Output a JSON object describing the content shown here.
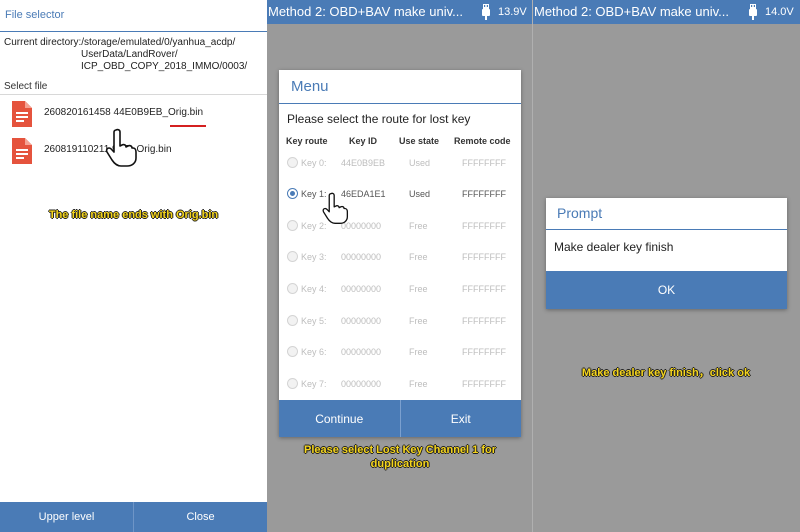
{
  "file_selector": {
    "title": "File selector",
    "current_directory_line1": "Current directory:/storage/emulated/0/yanhua_acdp/",
    "current_directory_line2": "UserData/LandRover/",
    "current_directory_line3": "ICP_OBD_COPY_2018_IMMO/0003/",
    "select_file_label": "Select file",
    "files": [
      {
        "name": "260820161458 44E0B9EB_Orig.bin",
        "icon": "document-icon"
      },
      {
        "name": "260819110211        9EB_Orig.bin",
        "icon": "document-icon"
      }
    ],
    "caption": "The file name ends with Orig.bin",
    "upper_level_label": "Upper level",
    "close_label": "Close"
  },
  "header_middle": {
    "title": "Method 2: OBD+BAV make univ...",
    "voltage": "13.9V",
    "icon": "usb-icon"
  },
  "header_right": {
    "title": "Method 2: OBD+BAV make univ...",
    "voltage": "14.0V",
    "icon": "usb-icon"
  },
  "menu": {
    "title": "Menu",
    "question": "Please select the route for lost key",
    "columns": [
      "Key route",
      "Key ID",
      "Use state",
      "Remote code"
    ],
    "rows": [
      {
        "route": "Key 0:",
        "id": "44E0B9EB",
        "state": "Used",
        "remote": "FFFFFFFF",
        "selected": false
      },
      {
        "route": "Key 1:",
        "id": "46EDA1E1",
        "state": "Used",
        "remote": "FFFFFFFF",
        "selected": true
      },
      {
        "route": "Key 2:",
        "id": "00000000",
        "state": "Free",
        "remote": "FFFFFFFF",
        "selected": false
      },
      {
        "route": "Key 3:",
        "id": "00000000",
        "state": "Free",
        "remote": "FFFFFFFF",
        "selected": false
      },
      {
        "route": "Key 4:",
        "id": "00000000",
        "state": "Free",
        "remote": "FFFFFFFF",
        "selected": false
      },
      {
        "route": "Key 5:",
        "id": "00000000",
        "state": "Free",
        "remote": "FFFFFFFF",
        "selected": false
      },
      {
        "route": "Key 6:",
        "id": "00000000",
        "state": "Free",
        "remote": "FFFFFFFF",
        "selected": false
      },
      {
        "route": "Key 7:",
        "id": "00000000",
        "state": "Free",
        "remote": "FFFFFFFF",
        "selected": false
      }
    ],
    "continue_label": "Continue",
    "exit_label": "Exit",
    "caption": "Please select Lost Key Channel 1 for duplication"
  },
  "prompt": {
    "title": "Prompt",
    "message": "Make dealer key finish",
    "ok_label": "OK",
    "caption": "Make dealer key finish，click ok"
  },
  "colors": {
    "accent": "#4a7bb6",
    "caption": "#f5d51c",
    "icon_red": "#e5533d",
    "underline": "#d42020"
  }
}
